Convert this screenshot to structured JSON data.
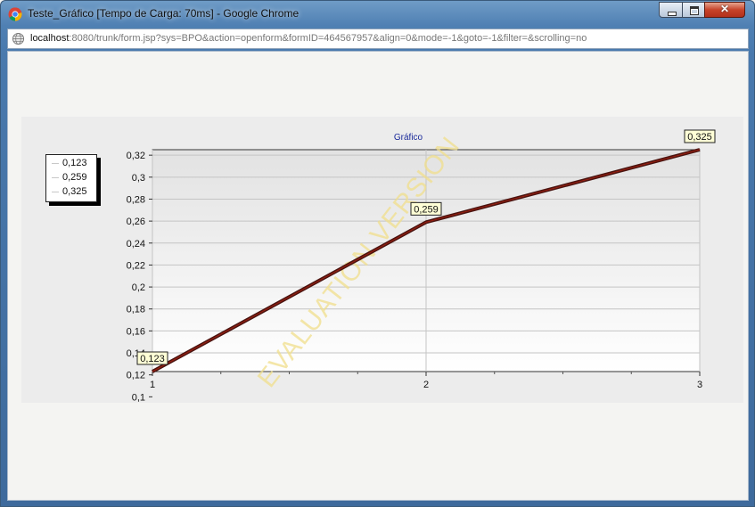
{
  "window": {
    "title": "Teste_Gráfico [Tempo de Carga: 70ms] - Google Chrome"
  },
  "addressbar": {
    "host": "localhost",
    "path": ":8080/trunk/form.jsp?sys=BPO&action=openform&formID=464567957&align=0&mode=-1&goto=-1&filter=&scrolling=no"
  },
  "icons": {
    "app": "chrome-icon",
    "page": "globe-icon",
    "minimize": "minimize-icon",
    "maximize": "maximize-icon",
    "close": "close-icon"
  },
  "watermark": "EVALUATION VERSION",
  "legend": {
    "items": [
      {
        "label": "0,123"
      },
      {
        "label": "0,259"
      },
      {
        "label": "0,325"
      }
    ]
  },
  "chart_data": {
    "type": "line",
    "title": "Gráfico",
    "x": [
      1,
      2,
      3
    ],
    "series": [
      {
        "values": [
          0.123,
          0.259,
          0.325
        ],
        "color": "#4a1410"
      }
    ],
    "data_labels": [
      "0,123",
      "0,259",
      "0,325"
    ],
    "xlim": [
      1,
      3
    ],
    "ylim": [
      0.123,
      0.325
    ],
    "x_ticks": [
      "1",
      "2",
      "3"
    ],
    "y_ticks": [
      "0,1",
      "0,12",
      "0,14",
      "0,16",
      "0,18",
      "0,2",
      "0,22",
      "0,24",
      "0,26",
      "0,28",
      "0,3",
      "0,32"
    ],
    "grid": true,
    "legend_position": "left"
  }
}
